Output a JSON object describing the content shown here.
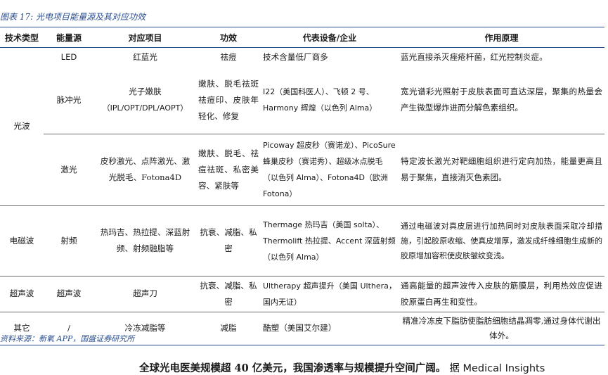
{
  "caption": "图表 17:  光电项目能量源及其对应功效",
  "headers": [
    "技术类型",
    "能量源",
    "对应项目",
    "功效",
    "代表设备/企业",
    "作用原理"
  ],
  "rows": {
    "optical_group": "光波",
    "led": {
      "source": "LED",
      "project": "红蓝光",
      "effect": "祛痘",
      "device": "技术含量低厂商多",
      "principle": "蓝光直接杀灭痤疮杆菌，红光控制炎症。"
    },
    "ipl": {
      "source": "脉冲光",
      "project_line1": "光子嫩肤",
      "project_line2": "（IPL/OPT/DPL/AOPT）",
      "effect": "嫩肤、脱毛祛斑祛痘印、皮肤年轻化、修复",
      "device": "I22（美国科医人）、飞顿 2 号、Harmony 辉煌（以色列 Alma）",
      "principle": "宽光谱彩光照射于皮肤表面可直达深层，聚集的热量会产生微型爆炸进而分解色素组织。"
    },
    "laser": {
      "source": "激光",
      "project": "皮秒激光、点阵激光、激光脱毛、Fotona4D",
      "effect": "嫩肤、脱毛、祛痘祛斑、私密美容、紧肤等",
      "device": "Picoway 超皮秒（赛诺龙）、PicoSure 蜂巢皮秒（赛诺秀）、超级冰点脱毛（以色列 Alma）、Fotona4D（欧洲 Fotona）",
      "principle": "特定波长激光对靶细胞组织进行定向加热，能量更高且易于聚焦，直接消灭色素团。"
    },
    "em": {
      "type": "电磁波",
      "source": "射频",
      "project": "热玛吉、热拉提、深蓝射频、射频融脂等",
      "effect": "抗衰、减脂、私密",
      "device": "Thermage 热玛吉（美国 solta）、Thermolift 热拉提、Accent 深蓝射频（以色列 Alma）",
      "principle": "通过电磁波对真皮层进行加热同时对皮肤表面采取冷却措施，引起胶原收缩、使真皮增厚，激发成纤维细胞生成新的胶原增加容积使皮肤皱纹变浅。"
    },
    "us": {
      "type": "超声波",
      "source": "超声波",
      "project": "超声刀",
      "effect": "抗衰、减脂、私密",
      "device": "Ultherapy 超声提升（美国 Ulthera，国内无证）",
      "principle": "通高能量的超声波传入皮肤的筋膜层，利用热效应促进胶原蛋白再生和变性。"
    },
    "other": {
      "type": "其它",
      "source": "/",
      "project": "冷冻减脂等",
      "effect": "减脂",
      "device": "酷塑（美国艾尔建）",
      "principle": "精准冷冻皮下脂肪使脂肪细胞结晶凋零,通过身体代谢出体外。"
    }
  },
  "source_note": "资料来源：新氧 APP，国盛证券研究所",
  "next_heading": "全球光电医美规模超 40 亿美元，我国渗透率与规模提升空间广阔。",
  "next_heading_source": "据 Medical Insights"
}
